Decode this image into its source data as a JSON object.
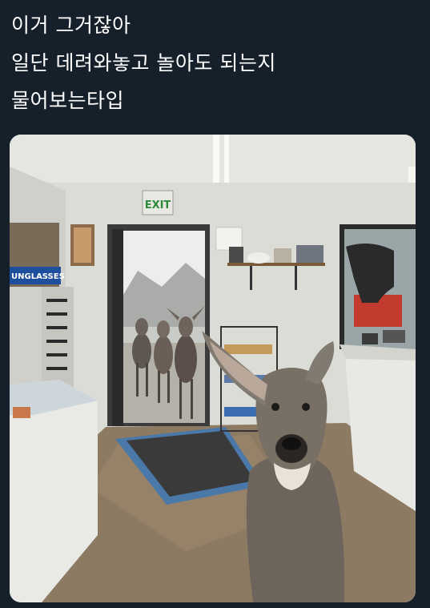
{
  "tweet": {
    "text_lines": [
      "이거 그거잖아",
      "일단 데려와놓고 놀아도 되는지",
      "물어보는타입"
    ]
  },
  "photo": {
    "subject": "deer-in-store-photo",
    "exit_sign": "EXIT",
    "sunglasses_sign": "UNGLASSES"
  },
  "colors": {
    "background": "#15202b",
    "text": "#ffffff"
  }
}
